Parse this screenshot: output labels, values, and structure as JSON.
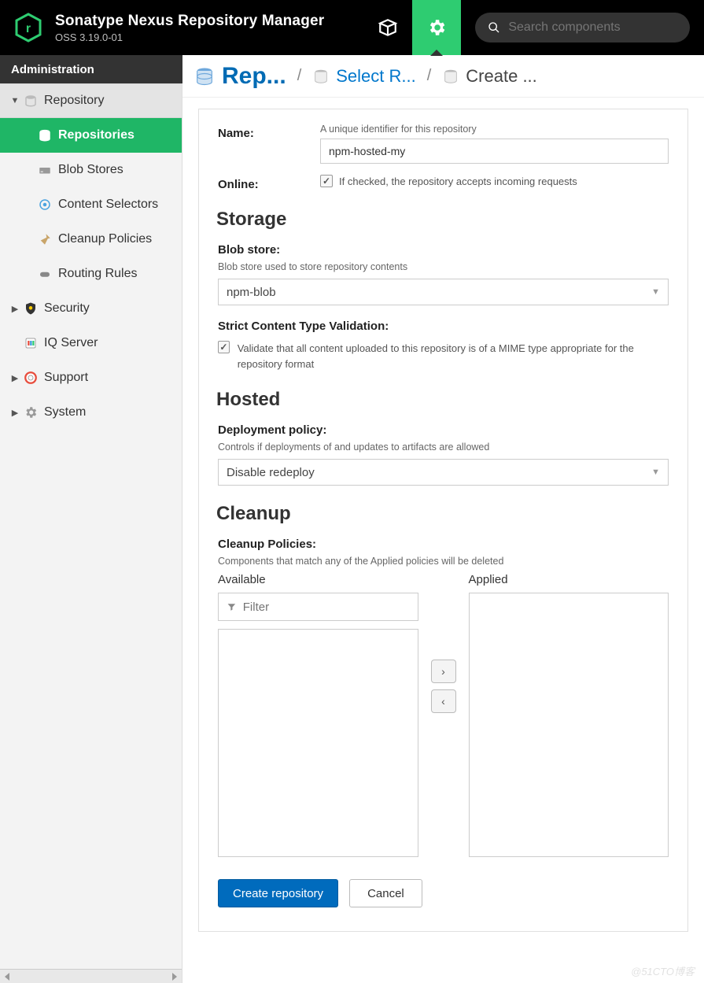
{
  "header": {
    "product_title": "Sonatype Nexus Repository Manager",
    "product_subtitle": "OSS 3.19.0-01",
    "search_placeholder": "Search components"
  },
  "admin_bar": {
    "label": "Administration"
  },
  "sidebar": {
    "items": [
      {
        "label": "Repository",
        "expandable": true,
        "expanded": true
      },
      {
        "label": "Repositories",
        "child": true,
        "active": true
      },
      {
        "label": "Blob Stores",
        "child": true
      },
      {
        "label": "Content Selectors",
        "child": true
      },
      {
        "label": "Cleanup Policies",
        "child": true
      },
      {
        "label": "Routing Rules",
        "child": true
      },
      {
        "label": "Security",
        "expandable": true,
        "expanded": false
      },
      {
        "label": "IQ Server",
        "expandable": false
      },
      {
        "label": "Support",
        "expandable": true,
        "expanded": false
      },
      {
        "label": "System",
        "expandable": true,
        "expanded": false
      }
    ]
  },
  "breadcrumb": {
    "c1": "Rep...",
    "c2": "Select R...",
    "c3": "Create ..."
  },
  "form": {
    "name_label": "Name:",
    "name_hint": "A unique identifier for this repository",
    "name_value": "npm-hosted-my",
    "online_label": "Online:",
    "online_hint": "If checked, the repository accepts incoming requests",
    "storage_heading": "Storage",
    "blob_label": "Blob store:",
    "blob_hint": "Blob store used to store repository contents",
    "blob_value": "npm-blob",
    "strict_label": "Strict Content Type Validation:",
    "strict_hint": "Validate that all content uploaded to this repository is of a MIME type appropriate for the repository format",
    "hosted_heading": "Hosted",
    "deploy_label": "Deployment policy:",
    "deploy_hint": "Controls if deployments of and updates to artifacts are allowed",
    "deploy_value": "Disable redeploy",
    "cleanup_heading": "Cleanup",
    "cleanup_label": "Cleanup Policies:",
    "cleanup_hint": "Components that match any of the Applied policies will be deleted",
    "available_label": "Available",
    "applied_label": "Applied",
    "filter_placeholder": "Filter",
    "create_btn": "Create repository",
    "cancel_btn": "Cancel"
  },
  "watermark": "@51CTO博客"
}
